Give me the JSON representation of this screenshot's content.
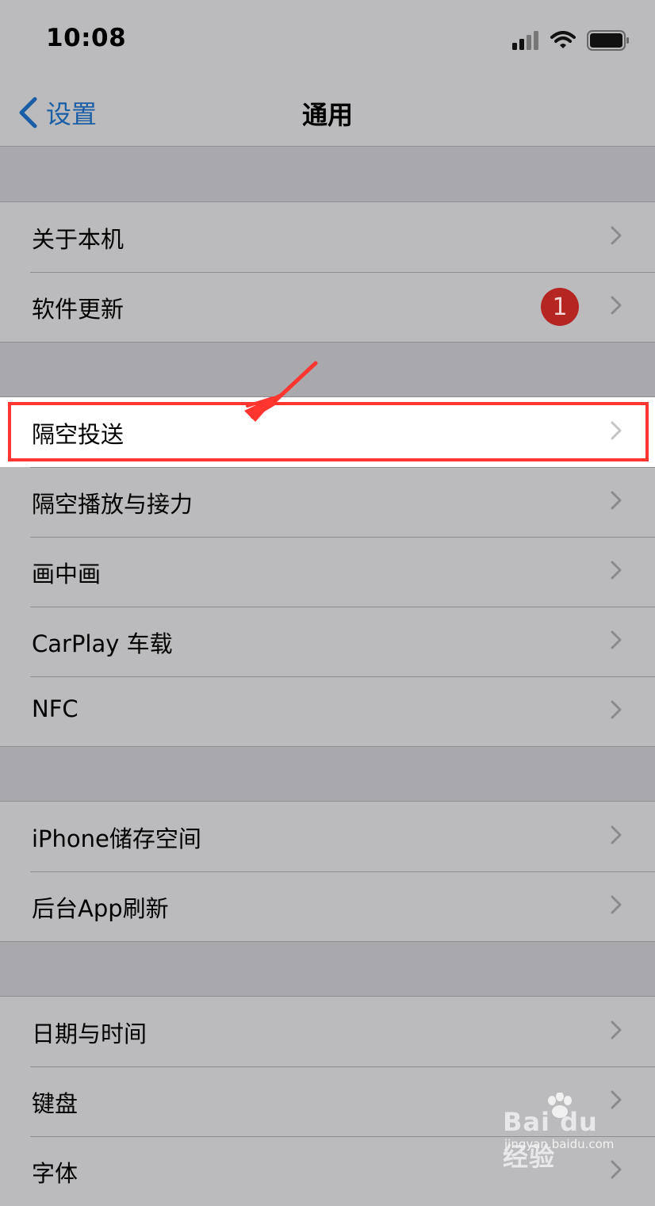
{
  "status": {
    "time": "10:08"
  },
  "nav": {
    "back_label": "设置",
    "title": "通用"
  },
  "groups": [
    [
      {
        "label": "关于本机"
      },
      {
        "label": "软件更新",
        "badge": "1"
      }
    ],
    [
      {
        "label": "隔空投送"
      },
      {
        "label": "隔空播放与接力"
      },
      {
        "label": "画中画"
      },
      {
        "label": "CarPlay 车载"
      },
      {
        "label": "NFC"
      }
    ],
    [
      {
        "label": "iPhone储存空间"
      },
      {
        "label": "后台App刷新"
      }
    ],
    [
      {
        "label": "日期与时间"
      },
      {
        "label": "键盘"
      },
      {
        "label": "字体"
      }
    ]
  ],
  "watermark": {
    "brand": "Bai du 经验",
    "url": "jingyan.baidu.com"
  },
  "colors": {
    "accent": "#1a5ea6",
    "badge": "#b52522",
    "highlight": "#ff3530"
  }
}
